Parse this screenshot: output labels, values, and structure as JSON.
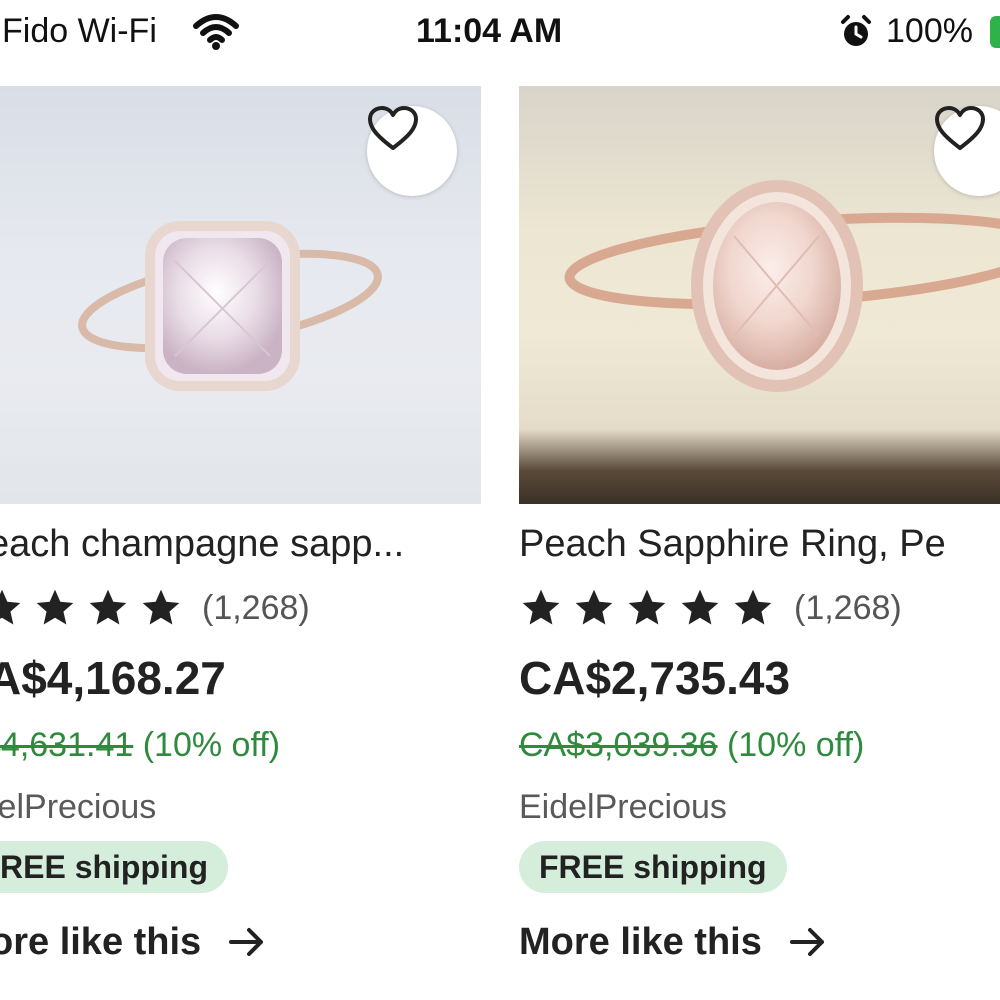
{
  "status_bar": {
    "carrier": "Fido Wi-Fi",
    "time": "11:04 AM",
    "battery": "100%",
    "battery_color": "#2eb34a"
  },
  "listings": [
    {
      "title": "each champagne sapp...",
      "rating_stars": 5,
      "review_count": "(1,268)",
      "price": "A$4,168.27",
      "original_price": "$4,631.41",
      "discount": "(10% off)",
      "shop": "lelPrecious",
      "shipping": "REE shipping",
      "more": "ore like this",
      "icons": {
        "favorite": "heart-outline-icon",
        "arrow": "arrow-right-icon"
      }
    },
    {
      "title": "Peach Sapphire Ring, Pe",
      "rating_stars": 5,
      "review_count": "(1,268)",
      "price": "CA$2,735.43",
      "original_price": "CA$3,039.36",
      "discount": "(10% off)",
      "shop": "EidelPrecious",
      "shipping": "FREE shipping",
      "more": "More like this",
      "icons": {
        "favorite": "heart-outline-icon",
        "arrow": "arrow-right-icon"
      }
    }
  ],
  "colors": {
    "discount_green": "#2e8b3e",
    "shipping_badge_bg": "#d4eedb",
    "star": "#222222"
  }
}
